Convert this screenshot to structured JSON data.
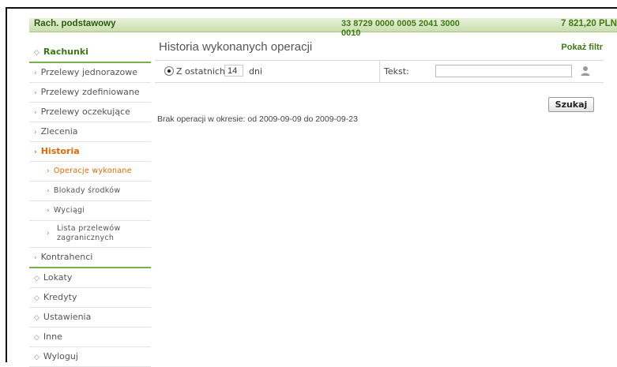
{
  "account": {
    "name": "Rach. podstawowy",
    "number": "33 8729 0000 0005 2041 3000 0010",
    "balance": "7 821,20 PLN"
  },
  "sidebar": {
    "section_title": "Rachunki",
    "items_top": [
      {
        "label": "Przelewy jednorazowe"
      },
      {
        "label": "Przelewy zdefiniowane"
      },
      {
        "label": "Przelewy oczekujące"
      },
      {
        "label": "Zlecenia"
      }
    ],
    "active_item": "Historia",
    "sub_items": [
      {
        "label": "Operacje wykonane"
      },
      {
        "label": "Blokady środków"
      },
      {
        "label": "Wyciągi"
      },
      {
        "label": "Lista przelewów zagranicznych"
      }
    ],
    "item_after_sub": "Kontrahenci",
    "groups": [
      {
        "label": "Lokaty"
      },
      {
        "label": "Kredyty"
      },
      {
        "label": "Ustawienia"
      },
      {
        "label": "Inne"
      },
      {
        "label": "Wyloguj"
      }
    ]
  },
  "content": {
    "page_title": "Historia wykonanych operacji",
    "filter_link": "Pokaż filtr",
    "filter": {
      "last_label": "Z ostatnich:",
      "days_value": "14",
      "days_unit": "dni",
      "text_label": "Tekst:",
      "text_value": ""
    },
    "search_button": "Szukaj",
    "no_operations_message": "Brak operacji w okresie: od 2009-09-09 do 2009-09-23"
  },
  "colors": {
    "accent_green": "#3a7a12",
    "active_orange": "#e06a00",
    "topbar_bg": "#d6e8c0"
  },
  "icons": {
    "nav_bullet": "chevron-bullet-icon",
    "section_bullet": "diamond-bullet-icon",
    "contact_picker": "person-icon"
  }
}
